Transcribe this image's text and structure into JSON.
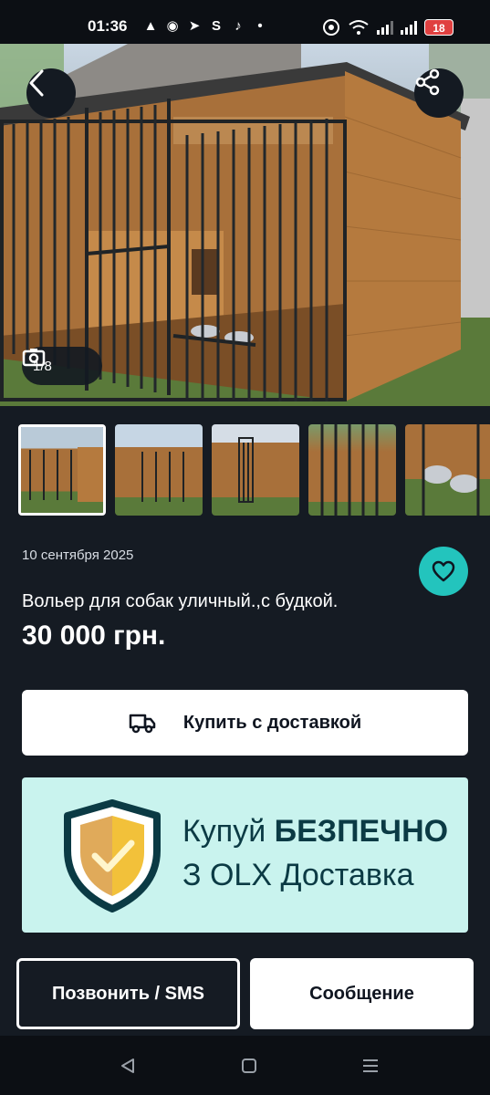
{
  "status_bar": {
    "time": "01:36",
    "left_icons": [
      "flame-icon",
      "instagram-icon",
      "telegram-icon",
      "s-app-icon",
      "tiktok-icon",
      "dot-icon"
    ],
    "battery": "18"
  },
  "gallery": {
    "counter": "1/8",
    "thumbnail_count": 5,
    "active_index": 0
  },
  "listing": {
    "date": "10 сентября 2025",
    "title": "Вольер для собак уличный.,с будкой.",
    "price": "30 000 грн."
  },
  "actions": {
    "buy_delivery_label": "Купить с доставкой",
    "call_label": "Позвонить / SMS",
    "message_label": "Сообщение"
  },
  "banner": {
    "line1_prefix": "Купуй ",
    "line1_bold": "БЕЗПЕЧНО",
    "line2": "З OLX Доставка"
  },
  "colors": {
    "background": "#151b23",
    "accent_teal": "#23c4bd",
    "banner_bg": "#c9f3ee",
    "banner_text": "#0b3a44",
    "shield_yellow": "#f2c13a"
  }
}
